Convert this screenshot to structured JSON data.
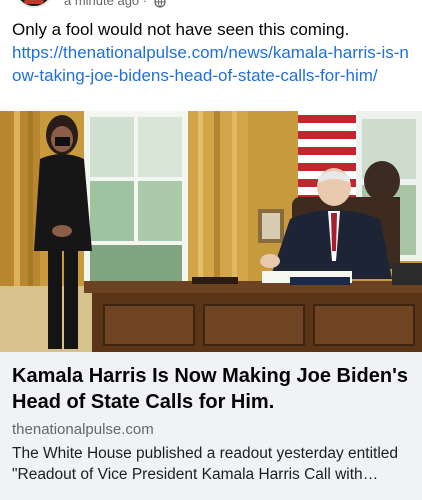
{
  "post": {
    "timestamp": "a minute ago",
    "separator": "·",
    "privacy_icon": "globe-icon",
    "text": "Only a fool would not have seen this coming.",
    "link_url": "https://thenationalpulse.com/news/kamala-harris-is-now-taking-joe-bidens-head-of-state-calls-for-him/"
  },
  "link_preview": {
    "title": "Kamala Harris Is Now Making Joe Biden's Head of State Calls for Him.",
    "domain": "thenationalpulse.com",
    "description": "The White House published a readout yesterday entitled \"Readout of Vice President Kamala Harris Call with President...\""
  },
  "colors": {
    "link": "#216fdb",
    "secondary_text": "#65676b",
    "card_background": "#f0f2f5"
  }
}
